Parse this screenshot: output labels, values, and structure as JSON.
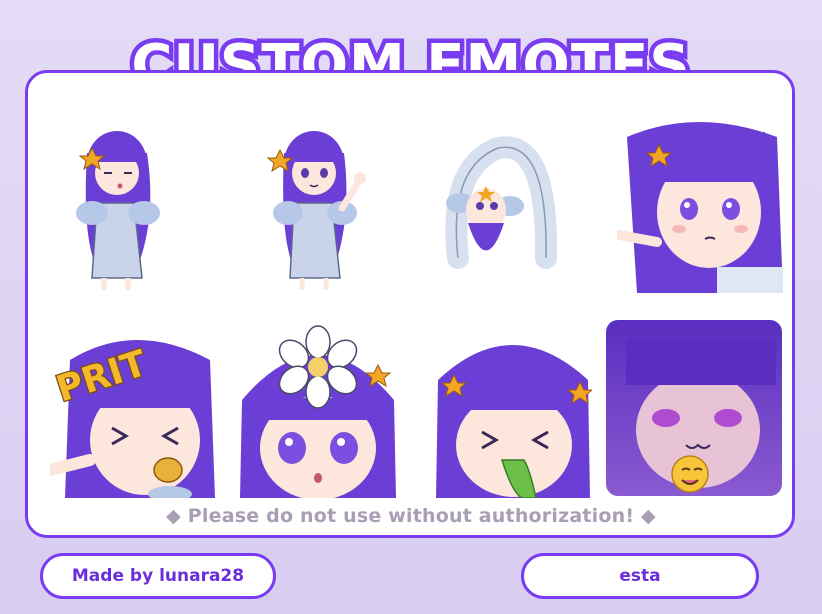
{
  "header": {
    "title": "CUSTOM EMOTES"
  },
  "notice": {
    "text": "◆ Please do not use without authorization! ◆"
  },
  "credits": {
    "author": "Made by lunara28",
    "character": "esta"
  },
  "emotes": [
    {
      "name": "whistle",
      "label": ""
    },
    {
      "name": "thumbs-up",
      "label": ""
    },
    {
      "name": "bridge-pose",
      "label": ""
    },
    {
      "name": "pointing",
      "label": ""
    },
    {
      "name": "prit",
      "label": "PRIT"
    },
    {
      "name": "flower-head",
      "label": ""
    },
    {
      "name": "sick",
      "label": ""
    },
    {
      "name": "smug",
      "label": ""
    }
  ],
  "colors": {
    "accent": "#7a3cf0",
    "hair": "#6b3fd6",
    "background": "#ddd3f3"
  }
}
